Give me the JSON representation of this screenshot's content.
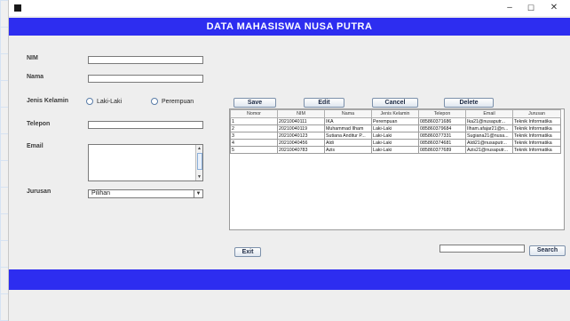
{
  "window": {
    "controls": {
      "minimize": "–",
      "maximize": "☐",
      "close": "✕"
    }
  },
  "header": {
    "title": "DATA MAHASISWA NUSA PUTRA"
  },
  "form": {
    "nim_label": "NIM",
    "nama_label": "Nama",
    "gender_label": "Jenis Kelamin",
    "gender_options": [
      "Laki-Laki",
      "Perempuan"
    ],
    "telepon_label": "Telepon",
    "email_label": "Email",
    "jurusan_label": "Jurusan",
    "jurusan_selected": "Pilihan"
  },
  "buttons": {
    "save": "Save",
    "edit": "Edit",
    "cancel": "Cancel",
    "delete": "Delete",
    "exit": "Exit",
    "search": "Search"
  },
  "table": {
    "columns": [
      "Nomor",
      "NIM",
      "Nama",
      "Jenis Kelamin",
      "Telepon",
      "Email",
      "Jurusan"
    ],
    "rows": [
      [
        "1",
        "20210040111",
        "IKA",
        "Perempuan",
        "085860371686",
        "Ika21@nusaputr...",
        "Teknik Informatika"
      ],
      [
        "2",
        "20210040119",
        "Muhammad Ilham",
        "Laki-Laki",
        "085860379684",
        "Ilham.afajar21@n...",
        "Teknik Informatika"
      ],
      [
        "3",
        "20210040123",
        "Sutiana Anditur P...",
        "Laki-Laki",
        "085860377331",
        "Sugiana21@nusa...",
        "Teknik Informatika"
      ],
      [
        "4",
        "20210040456",
        "Aldi",
        "Laki-Laki",
        "085860374681",
        "Aldi21@nusaputr...",
        "Teknik Informatika"
      ],
      [
        "5",
        "20210040783",
        "Azis",
        "Laki-Laki",
        "085860377689",
        "Azis21@nusaputr...",
        "Teknik Informatika"
      ]
    ]
  },
  "colors": {
    "accent": "#2d2df0"
  }
}
